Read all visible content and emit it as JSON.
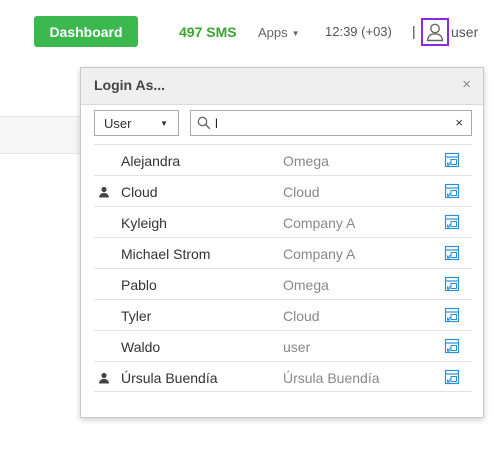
{
  "topbar": {
    "dashboard_label": "Dashboard",
    "sms_label": "497 SMS",
    "apps_label": "Apps",
    "time_label": "12:39 (+03)",
    "separator": "|",
    "user_label": "user"
  },
  "dialog": {
    "title": "Login As...",
    "close_label": "×",
    "filter": {
      "selected": "User",
      "search_value": "l",
      "clear_label": "×"
    },
    "rows": [
      {
        "name": "Alejandra",
        "company": "Omega",
        "has_person_icon": false
      },
      {
        "name": "Cloud",
        "company": "Cloud",
        "has_person_icon": true
      },
      {
        "name": "Kyleigh",
        "company": "Company A",
        "has_person_icon": false
      },
      {
        "name": "Michael Strom",
        "company": "Company A",
        "has_person_icon": false
      },
      {
        "name": "Pablo",
        "company": "Omega",
        "has_person_icon": false
      },
      {
        "name": "Tyler",
        "company": "Cloud",
        "has_person_icon": false
      },
      {
        "name": "Waldo",
        "company": "user",
        "has_person_icon": false
      },
      {
        "name": "Úrsula Buendía",
        "company": "Úrsula Buendía",
        "has_person_icon": true
      }
    ]
  },
  "colors": {
    "dashboard_bg": "#3cb94e",
    "sms_text": "#3aa532",
    "highlight_border": "#8a2be2",
    "login_icon": "#2a8fd6"
  },
  "icons": {
    "user": "user-outline-icon",
    "person": "person-icon",
    "login": "login-as-icon",
    "search": "search-icon"
  }
}
